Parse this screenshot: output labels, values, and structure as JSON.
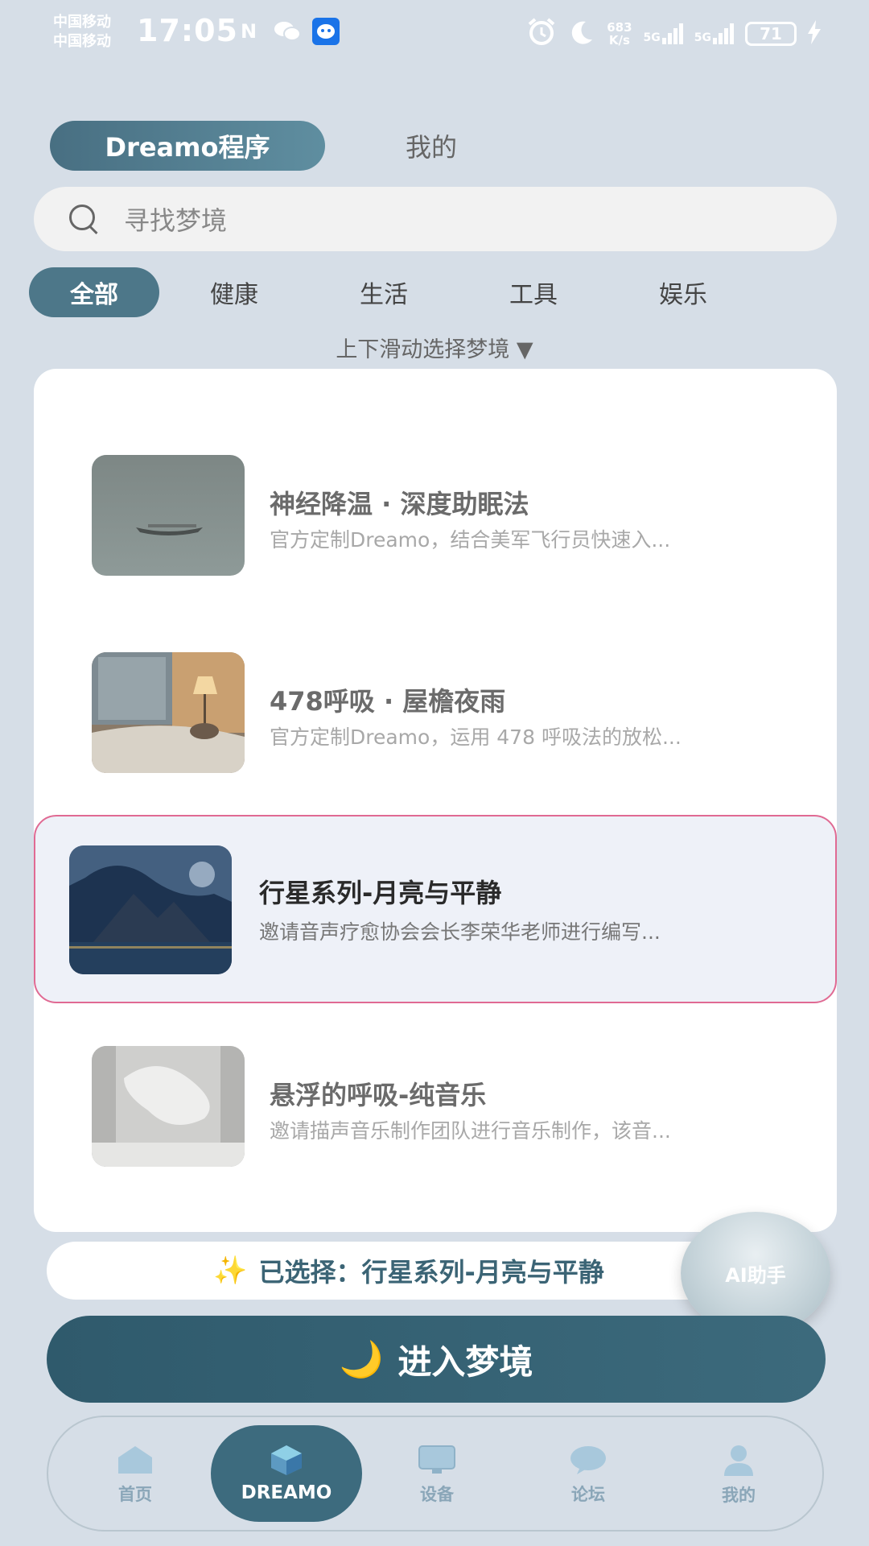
{
  "status_bar": {
    "carrier_1": "中国移动",
    "carrier_2": "中国移动",
    "time": "17:05",
    "speed_value": "683",
    "speed_unit": "K/s",
    "network_1": "5G",
    "network_2": "5G",
    "battery": "71"
  },
  "top_tabs": {
    "active": "Dreamo程序",
    "other": "我的"
  },
  "search": {
    "placeholder": "寻找梦境"
  },
  "categories": [
    "全部",
    "健康",
    "生活",
    "工具",
    "娱乐"
  ],
  "hint": "上下滑动选择梦境 ▼",
  "dreams": [
    {
      "title": "神经降温 · 深度助眠法",
      "desc": "官方定制Dreamo，结合美军飞行员快速入..."
    },
    {
      "title": "478呼吸 · 屋檐夜雨",
      "desc": "官方定制Dreamo，运用 478 呼吸法的放松..."
    },
    {
      "title": "行星系列-月亮与平静",
      "desc": "邀请音声疗愈协会会长李荣华老师进行编写..."
    },
    {
      "title": "悬浮的呼吸-纯音乐",
      "desc": "邀请描声音乐制作团队进行音乐制作，该音..."
    }
  ],
  "selected": {
    "icon": "sparkles-icon",
    "text": "已选择：行星系列-月亮与平静"
  },
  "ai_assistant": "AI助手",
  "enter_button": {
    "icon": "moon-icon",
    "label": "进入梦境"
  },
  "bottom_nav": [
    "首页",
    "DREAMO",
    "设备",
    "论坛",
    "我的"
  ],
  "colors": {
    "primary": "#3d6b7e",
    "selected_border": "#e06a93",
    "background": "#d6dee7"
  }
}
